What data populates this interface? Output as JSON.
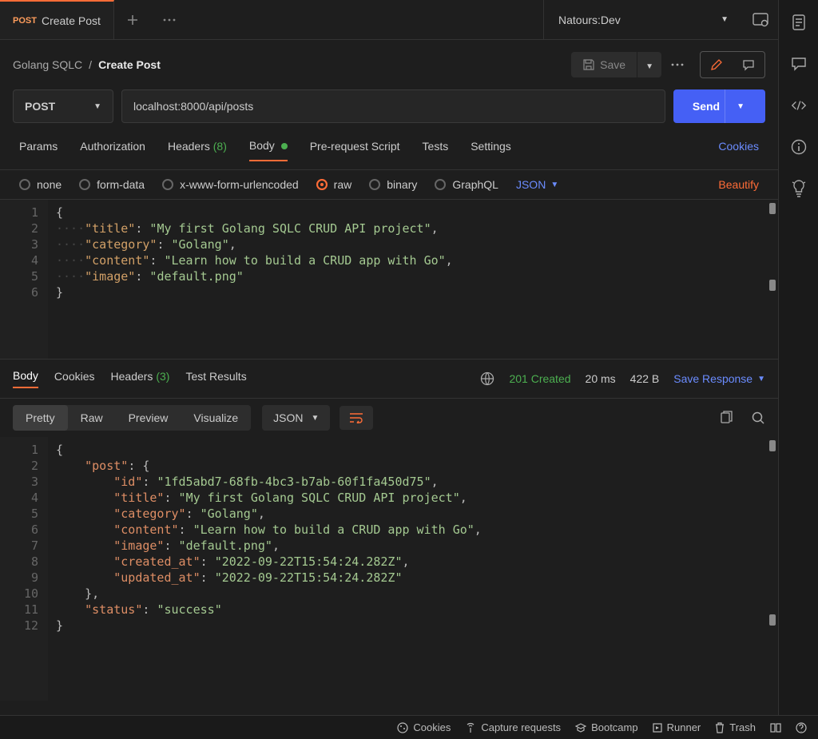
{
  "tab": {
    "method": "POST",
    "title": "Create Post"
  },
  "environment": {
    "name": "Natours:Dev"
  },
  "breadcrumb": {
    "collection": "Golang SQLC",
    "separator": "/",
    "request": "Create Post"
  },
  "actions": {
    "save": "Save"
  },
  "method": "POST",
  "url": "localhost:8000/api/posts",
  "send": "Send",
  "reqTabs": {
    "params": "Params",
    "authorization": "Authorization",
    "headers": "Headers",
    "headersCount": "(8)",
    "body": "Body",
    "prerequest": "Pre-request Script",
    "tests": "Tests",
    "settings": "Settings",
    "cookies": "Cookies"
  },
  "bodyTypes": {
    "none": "none",
    "formdata": "form-data",
    "xwww": "x-www-form-urlencoded",
    "raw": "raw",
    "binary": "binary",
    "graphql": "GraphQL",
    "contentType": "JSON",
    "beautify": "Beautify"
  },
  "requestBody": {
    "title": "My first Golang SQLC CRUD API project",
    "category": "Golang",
    "content": "Learn how to build a CRUD app with Go",
    "image": "default.png"
  },
  "respTabs": {
    "body": "Body",
    "cookies": "Cookies",
    "headers": "Headers",
    "headersCount": "(3)",
    "testResults": "Test Results"
  },
  "responseMeta": {
    "status": "201 Created",
    "time": "20 ms",
    "size": "422 B",
    "saveResponse": "Save Response"
  },
  "responseViews": {
    "pretty": "Pretty",
    "raw": "Raw",
    "preview": "Preview",
    "visualize": "Visualize",
    "format": "JSON"
  },
  "responseBody": {
    "post": {
      "id": "1fd5abd7-68fb-4bc3-b7ab-60f1fa450d75",
      "title": "My first Golang SQLC CRUD API project",
      "category": "Golang",
      "content": "Learn how to build a CRUD app with Go",
      "image": "default.png",
      "created_at": "2022-09-22T15:54:24.282Z",
      "updated_at": "2022-09-22T15:54:24.282Z"
    },
    "status": "success"
  },
  "footer": {
    "cookies": "Cookies",
    "capture": "Capture requests",
    "bootcamp": "Bootcamp",
    "runner": "Runner",
    "trash": "Trash"
  }
}
